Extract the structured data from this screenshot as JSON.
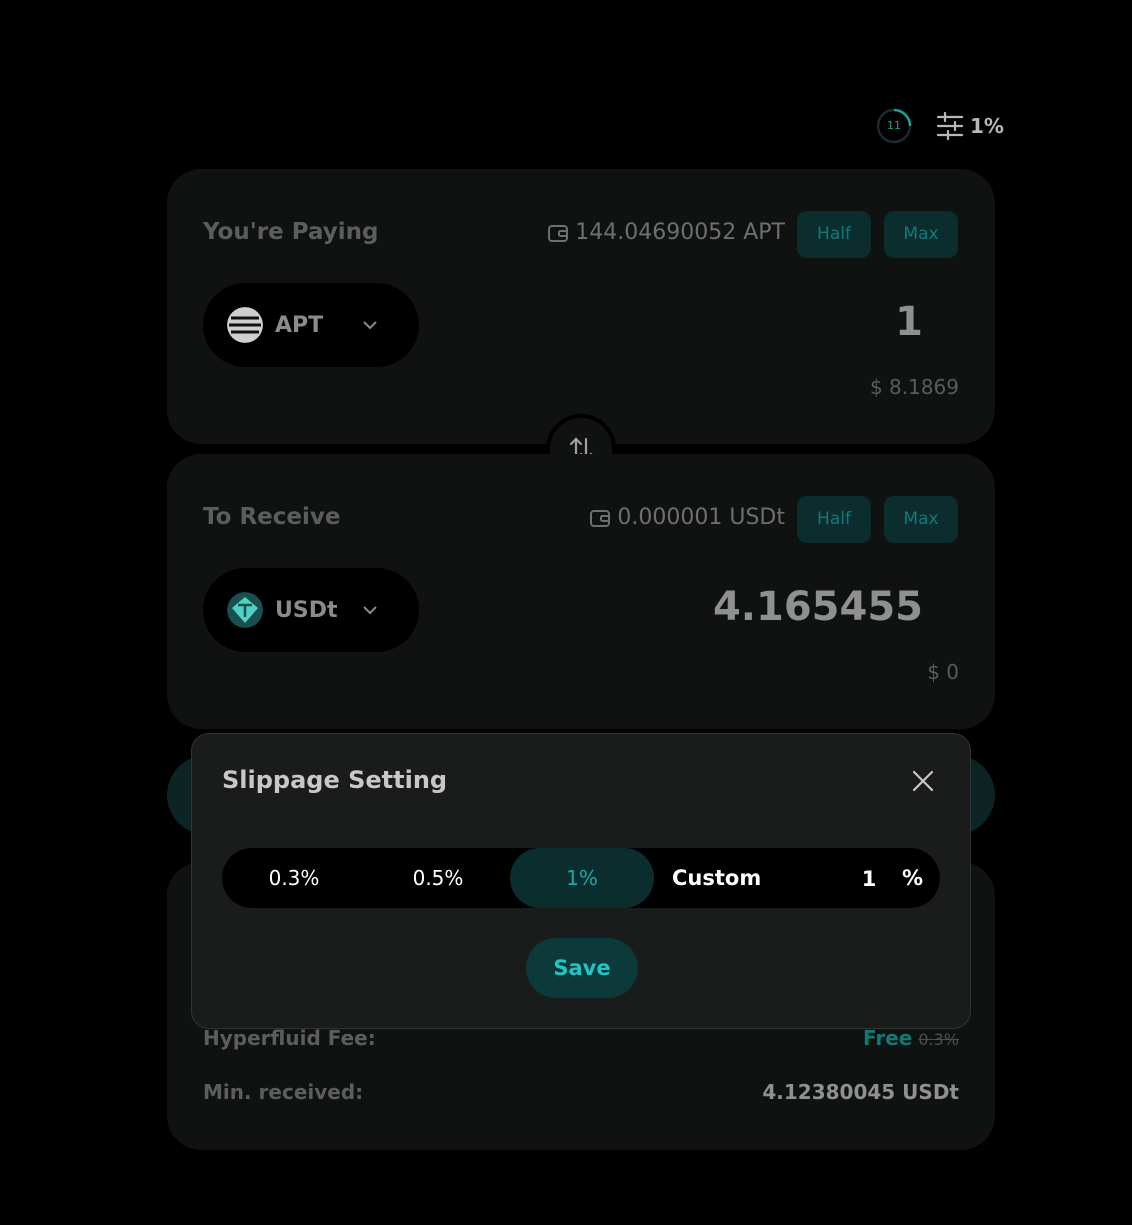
{
  "top": {
    "refresh_count": "11",
    "slippage_display": "1%"
  },
  "pay": {
    "label": "You're Paying",
    "balance": "144.04690052 APT",
    "half_label": "Half",
    "max_label": "Max",
    "token": "APT",
    "amount": "1",
    "usd_value": "$ 8.1869"
  },
  "receive": {
    "label": "To Receive",
    "balance": "0.000001 USDt",
    "half_label": "Half",
    "max_label": "Max",
    "token": "USDt",
    "amount": "4.165455",
    "usd_value": "$ 0"
  },
  "details": {
    "fee_label": "Hyperfluid Fee:",
    "fee_value": "Free",
    "fee_original": "0.3%",
    "min_received_label": "Min. received:",
    "min_received_value": "4.12380045 USDt"
  },
  "modal": {
    "title": "Slippage Setting",
    "options": [
      "0.3%",
      "0.5%",
      "1%"
    ],
    "selected": "1%",
    "custom_label": "Custom",
    "custom_value": "1",
    "percent_sign": "%",
    "save_label": "Save"
  },
  "colors": {
    "accent": "#1aa9a9",
    "accent_bg": "#0c2d2e",
    "card": "#101111",
    "modal": "#1a1b1b"
  }
}
